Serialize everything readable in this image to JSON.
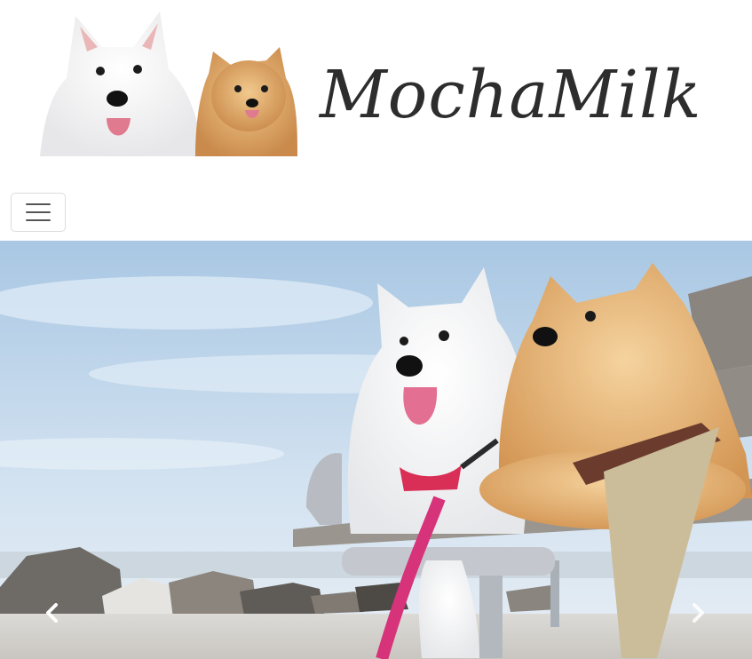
{
  "brand": {
    "name": "MochaMilk"
  },
  "logo": {
    "alt": "samoyed-and-pomeranian-logo"
  },
  "navbar": {
    "toggler_icon": "hamburger-icon"
  },
  "carousel": {
    "slide_alt": "samoyed-and-pomeranian-on-bench",
    "prev_icon": "chevron-left-icon",
    "next_icon": "chevron-right-icon"
  },
  "colors": {
    "brand_text": "#2d2d2d",
    "sky": "#b9d3ea",
    "bench": "#8f8b86",
    "leash": "#d6337a"
  }
}
